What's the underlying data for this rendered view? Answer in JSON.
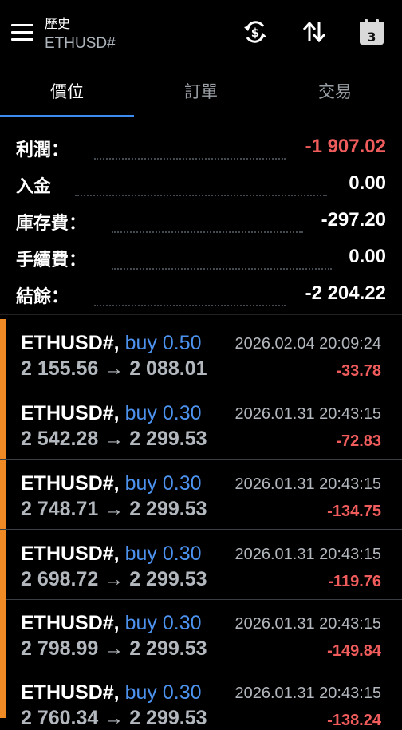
{
  "header": {
    "title": "歷史",
    "subtitle": "ETHUSD#",
    "calendar_day": "3"
  },
  "tabs": [
    {
      "label": "價位",
      "active": true
    },
    {
      "label": "訂單",
      "active": false
    },
    {
      "label": "交易",
      "active": false
    }
  ],
  "summary": [
    {
      "label": "利潤：",
      "value": "-1 907.02"
    },
    {
      "label": "入金",
      "value": "0.00"
    },
    {
      "label": "庫存費：",
      "value": "-297.20"
    },
    {
      "label": "手續費：",
      "value": "0.00"
    },
    {
      "label": "結餘：",
      "value": "-2 204.22"
    }
  ],
  "deals": [
    {
      "symbol": "ETHUSD#,",
      "side": "buy 0.50",
      "prices": "2 155.56 → 2 088.01",
      "time": "2026.02.04 20:09:24",
      "profit": "-33.78"
    },
    {
      "symbol": "ETHUSD#,",
      "side": "buy 0.30",
      "prices": "2 542.28 → 2 299.53",
      "time": "2026.01.31 20:43:15",
      "profit": "-72.83"
    },
    {
      "symbol": "ETHUSD#,",
      "side": "buy 0.30",
      "prices": "2 748.71 → 2 299.53",
      "time": "2026.01.31 20:43:15",
      "profit": "-134.75"
    },
    {
      "symbol": "ETHUSD#,",
      "side": "buy 0.30",
      "prices": "2 698.72 → 2 299.53",
      "time": "2026.01.31 20:43:15",
      "profit": "-119.76"
    },
    {
      "symbol": "ETHUSD#,",
      "side": "buy 0.30",
      "prices": "2 798.99 → 2 299.53",
      "time": "2026.01.31 20:43:15",
      "profit": "-149.84"
    },
    {
      "symbol": "ETHUSD#,",
      "side": "buy 0.30",
      "prices": "2 760.34 → 2 299.53",
      "time": "2026.01.31 20:43:15",
      "profit": "-138.24"
    }
  ],
  "colors": {
    "accent": "#3e8bf0",
    "negative": "#f05c5c",
    "buy": "#4c92ee",
    "deal_bar": "#f08a24"
  },
  "icons": [
    "menu-icon",
    "sync-currency-icon",
    "sort-icon",
    "calendar-icon"
  ]
}
